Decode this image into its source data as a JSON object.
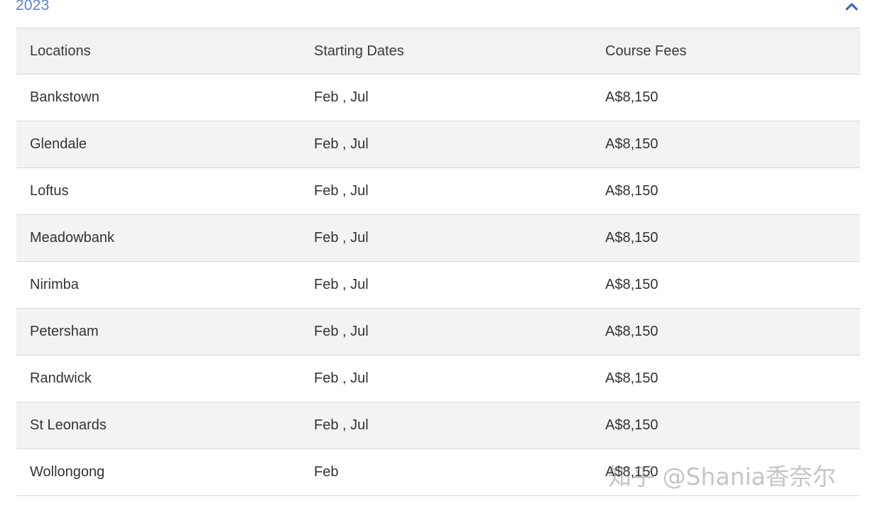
{
  "accordion": {
    "year": "2023",
    "toggle_icon": "chevron-up-icon",
    "accent_color": "#5b7fe0"
  },
  "table": {
    "headers": [
      "Locations",
      "Starting Dates",
      "Course Fees"
    ],
    "rows": [
      {
        "location": "Bankstown",
        "dates": "Feb , Jul",
        "fee": "A$8,150"
      },
      {
        "location": "Glendale",
        "dates": "Feb , Jul",
        "fee": "A$8,150"
      },
      {
        "location": "Loftus",
        "dates": "Feb , Jul",
        "fee": "A$8,150"
      },
      {
        "location": "Meadowbank",
        "dates": "Feb , Jul",
        "fee": "A$8,150"
      },
      {
        "location": "Nirimba",
        "dates": "Feb , Jul",
        "fee": "A$8,150"
      },
      {
        "location": "Petersham",
        "dates": "Feb , Jul",
        "fee": "A$8,150"
      },
      {
        "location": "Randwick",
        "dates": "Feb , Jul",
        "fee": "A$8,150"
      },
      {
        "location": "St Leonards",
        "dates": "Feb , Jul",
        "fee": "A$8,150"
      },
      {
        "location": "Wollongong",
        "dates": "Feb",
        "fee": "A$8,150"
      }
    ]
  },
  "watermark": "知乎 @Shania香奈尔"
}
